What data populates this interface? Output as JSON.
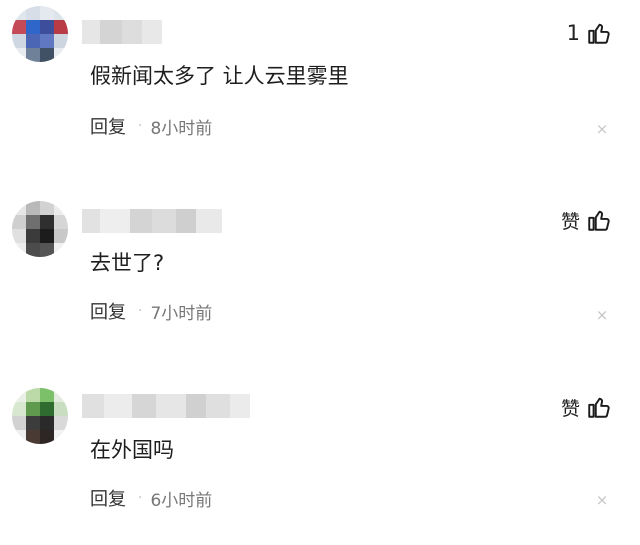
{
  "comments": [
    {
      "like": "1",
      "text": "假新闻太多了 让人云里雾里",
      "reply": "回复",
      "time": "8小时前",
      "close": "×"
    },
    {
      "like": "赞",
      "text": "去世了?",
      "reply": "回复",
      "time": "7小时前",
      "close": "×"
    },
    {
      "like": "赞",
      "text": "在外国吗",
      "reply": "回复",
      "time": "6小时前",
      "close": "×"
    }
  ],
  "separator": "·",
  "icons": {
    "like": "thumb-up-icon",
    "close": "close-icon"
  },
  "colors": {
    "text": "#1e1e1e",
    "meta": "#777777",
    "close": "#c6c6c6"
  }
}
